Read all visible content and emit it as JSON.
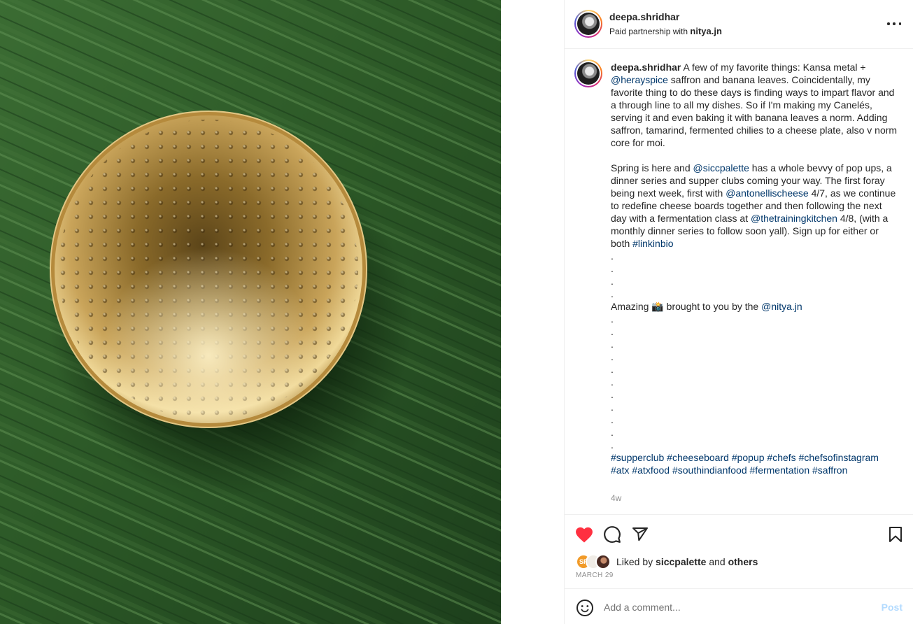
{
  "post": {
    "username": "deepa.shridhar",
    "partnership_prefix": "Paid partnership with",
    "partner": "nitya.jn"
  },
  "caption": {
    "username": "deepa.shridhar",
    "p1_text1": " A few of my favorite things: Kansa metal + ",
    "p1_link1": "@herayspice",
    "p1_text2": " saffron and banana leaves. Coincidentally, my favorite thing to do these days is finding ways to impart flavor and a through line to all my dishes. So if I'm making my Canelés, serving it and even baking it with banana leaves a norm. Adding saffron, tamarind, fermented chilies to a cheese plate, also v norm core for moi.",
    "p2_text1": "Spring is here and ",
    "p2_link1": "@siccpalette",
    "p2_text2": " has a whole bevvy of pop ups, a dinner series and supper clubs coming your way. The first foray being next week, first with ",
    "p2_link2": "@antonellischeese",
    "p2_text3": " 4/7, as we continue to redefine cheese boards together and then following the next day with a fermentation class at ",
    "p2_link3": "@thetrainingkitchen",
    "p2_text4": " 4/8, (with a monthly dinner series to follow soon yall). Sign up for either or both ",
    "p2_link4": "#linkinbio",
    "dot": ".",
    "p3_text1": "Amazing 📸 brought to you by the ",
    "p3_link1": "@nitya.jn",
    "hashtags": [
      "#supperclub",
      "#cheeseboard",
      "#popup",
      "#chefs",
      "#chefsofinstagram",
      "#atx",
      "#atxfood",
      "#southindianfood",
      "#fermentation",
      "#saffron"
    ],
    "age": "4w"
  },
  "likes": {
    "prefix": "Liked by",
    "user": "siccpalette",
    "and": "and",
    "others": "others",
    "liker_initials": "SP"
  },
  "date": "MARCH 29",
  "comment": {
    "placeholder": "Add a comment...",
    "post_label": "Post"
  },
  "icons": {
    "heart": "heart-filled-icon",
    "comment": "comment-icon",
    "share": "share-icon",
    "bookmark": "bookmark-icon",
    "emoji": "emoji-icon",
    "more": "more-icon"
  },
  "colors": {
    "heart": "#ff3040",
    "link": "#00376b",
    "post_button": "#b3dbff"
  }
}
